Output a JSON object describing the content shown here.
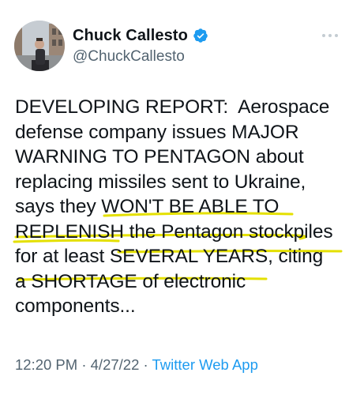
{
  "user": {
    "display_name": "Chuck Callesto",
    "handle": "@ChuckCallesto"
  },
  "icons": {
    "verified": "verified-badge-icon",
    "more": "more-options-icon"
  },
  "tweet": {
    "lines": [
      "DEVELOPING REPORT:  Aerospace",
      "defense company issues MAJOR",
      "WARNING TO PENTAGON about",
      "replacing missiles sent to Ukraine,",
      "says they WON'T BE ABLE TO",
      "REPLENISH the Pentagon stockpiles",
      "for at least SEVERAL YEARS, citing",
      "a SHORTAGE of electronic",
      "components..."
    ]
  },
  "meta": {
    "time": "12:20 PM",
    "separator": "·",
    "date": "4/27/22",
    "source": "Twitter Web App"
  },
  "colors": {
    "text": "#0f1419",
    "secondary": "#536471",
    "accent": "#1d9bf0",
    "highlight": "#e4e000"
  }
}
